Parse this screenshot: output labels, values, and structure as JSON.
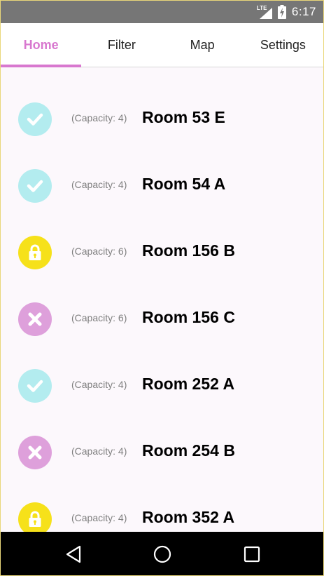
{
  "status_bar": {
    "network": "LTE",
    "time": "6:17",
    "icons": [
      "lte-signal-icon",
      "battery-charging-icon"
    ]
  },
  "tabs": [
    {
      "label": "Home",
      "active": true
    },
    {
      "label": "Filter",
      "active": false
    },
    {
      "label": "Map",
      "active": false
    },
    {
      "label": "Settings",
      "active": false
    }
  ],
  "rooms": [
    {
      "status": "available",
      "icon": "check-icon",
      "capacity": "(Capacity: 4)",
      "name": "Room 53 E"
    },
    {
      "status": "available",
      "icon": "check-icon",
      "capacity": "(Capacity: 4)",
      "name": "Room 54 A"
    },
    {
      "status": "locked",
      "icon": "lock-icon",
      "capacity": "(Capacity: 6)",
      "name": "Room 156 B"
    },
    {
      "status": "occupied",
      "icon": "x-icon",
      "capacity": "(Capacity: 6)",
      "name": "Room 156 C"
    },
    {
      "status": "available",
      "icon": "check-icon",
      "capacity": "(Capacity: 4)",
      "name": "Room 252 A"
    },
    {
      "status": "occupied",
      "icon": "x-icon",
      "capacity": "(Capacity: 4)",
      "name": "Room 254 B"
    },
    {
      "status": "locked",
      "icon": "lock-icon",
      "capacity": "(Capacity: 4)",
      "name": "Room 352 A"
    }
  ],
  "colors": {
    "accent": "#d878cf",
    "available": "#b3ecef",
    "locked": "#f6e11a",
    "occupied": "#dea0db"
  },
  "nav_bar": {
    "icons": [
      "back-icon",
      "home-circle-icon",
      "recents-square-icon"
    ]
  }
}
